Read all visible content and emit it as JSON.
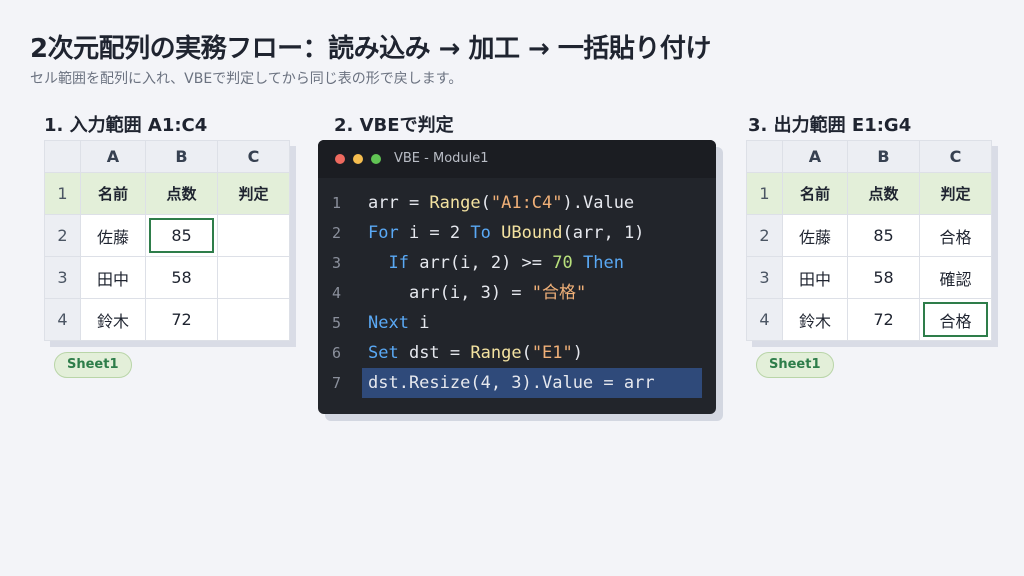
{
  "title": "2次元配列の実務フロー：読み込み → 加工 → 一括貼り付け",
  "subtitle": "セル範囲を配列に入れ、VBEで判定してから同じ表の形で戻します。",
  "sections": {
    "input_label": "1. 入力範囲 A1:C4",
    "vbe_label": "2. VBEで判定",
    "output_label": "3. 出力範囲 E1:G4"
  },
  "input_sheet": {
    "col_headers": [
      "A",
      "B",
      "C"
    ],
    "rows": [
      {
        "num": "1",
        "cells": [
          "名前",
          "点数",
          "判定"
        ]
      },
      {
        "num": "2",
        "cells": [
          "佐藤",
          "85",
          ""
        ]
      },
      {
        "num": "3",
        "cells": [
          "田中",
          "58",
          ""
        ]
      },
      {
        "num": "4",
        "cells": [
          "鈴木",
          "72",
          ""
        ]
      }
    ],
    "tab": "Sheet1"
  },
  "output_sheet": {
    "col_headers": [
      "A",
      "B",
      "C"
    ],
    "rows": [
      {
        "num": "1",
        "cells": [
          "名前",
          "点数",
          "判定"
        ]
      },
      {
        "num": "2",
        "cells": [
          "佐藤",
          "85",
          "合格"
        ]
      },
      {
        "num": "3",
        "cells": [
          "田中",
          "58",
          "確認"
        ]
      },
      {
        "num": "4",
        "cells": [
          "鈴木",
          "72",
          "合格"
        ]
      }
    ],
    "tab": "Sheet1"
  },
  "editor": {
    "window_title": "VBE - Module1",
    "lines": [
      {
        "num": "1",
        "tokens": [
          [
            "tx",
            "arr = "
          ],
          [
            "fn",
            "Range"
          ],
          [
            "tx",
            "("
          ],
          [
            "st",
            "\"A1:C4\""
          ],
          [
            "tx",
            ").Value"
          ]
        ]
      },
      {
        "num": "2",
        "tokens": [
          [
            "kw",
            "For"
          ],
          [
            "tx",
            " i = 2 "
          ],
          [
            "kw",
            "To"
          ],
          [
            "tx",
            " "
          ],
          [
            "fn",
            "UBound"
          ],
          [
            "tx",
            "(arr, 1)"
          ]
        ]
      },
      {
        "num": "3",
        "tokens": [
          [
            "tx",
            "  "
          ],
          [
            "kw",
            "If"
          ],
          [
            "tx",
            " arr(i, 2) >= "
          ],
          [
            "nm",
            "70"
          ],
          [
            "tx",
            " "
          ],
          [
            "kw",
            "Then"
          ]
        ]
      },
      {
        "num": "4",
        "tokens": [
          [
            "tx",
            "    arr(i, 3) = "
          ],
          [
            "st",
            "\"合格\""
          ]
        ]
      },
      {
        "num": "5",
        "tokens": [
          [
            "kw",
            "Next"
          ],
          [
            "tx",
            " i"
          ]
        ]
      },
      {
        "num": "6",
        "tokens": [
          [
            "kw",
            "Set"
          ],
          [
            "tx",
            " dst = "
          ],
          [
            "fn",
            "Range"
          ],
          [
            "tx",
            "("
          ],
          [
            "st",
            "\"E1\""
          ],
          [
            "tx",
            ")"
          ]
        ]
      },
      {
        "num": "7",
        "tokens": [
          [
            "tx",
            "dst.Resize(4, 3).Value = arr"
          ]
        ]
      }
    ]
  },
  "colors": {
    "header_row_bg": "#e3efd9",
    "selection_border": "#2e7d4a",
    "editor_bg": "#22252b",
    "highlight_line": "#2f4a7a"
  }
}
